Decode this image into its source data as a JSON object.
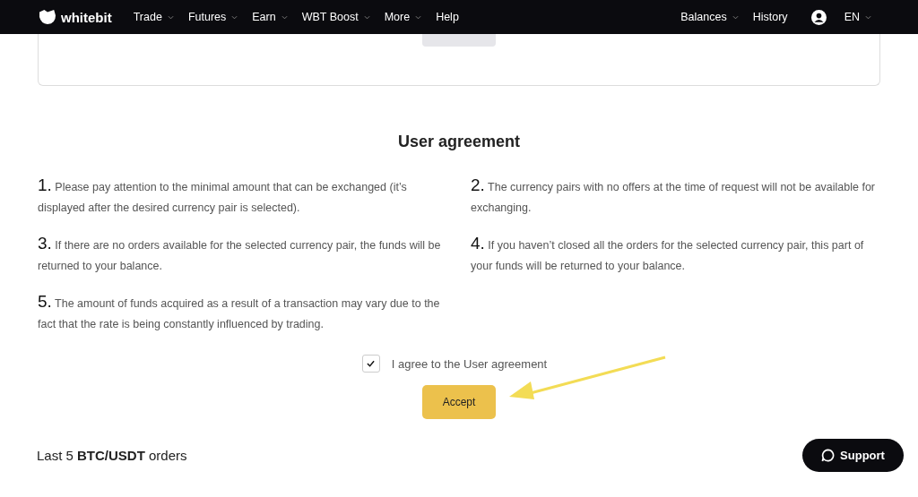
{
  "nav": {
    "logo": "whitebit",
    "menu": [
      {
        "label": "Trade",
        "dropdown": true
      },
      {
        "label": "Futures",
        "dropdown": true
      },
      {
        "label": "Earn",
        "dropdown": true
      },
      {
        "label": "WBT Boost",
        "dropdown": true
      },
      {
        "label": "More",
        "dropdown": true
      },
      {
        "label": "Help",
        "dropdown": false
      }
    ],
    "right": [
      {
        "label": "Balances",
        "dropdown": true
      },
      {
        "label": "History",
        "dropdown": false
      }
    ],
    "language": "EN"
  },
  "agreement": {
    "title": "User agreement",
    "items": [
      {
        "number": "1.",
        "text": "Please pay attention to the minimal amount that can be exchanged (it’s displayed after the desired currency pair is selected)."
      },
      {
        "number": "2.",
        "text": "The currency pairs with no offers at the time of request will not be available for exchanging."
      },
      {
        "number": "3.",
        "text": "If there are no orders available for the selected currency pair, the funds will be returned to your balance."
      },
      {
        "number": "4.",
        "text": "If you haven’t closed all the orders for the selected currency pair, this part of your funds will be returned to your balance."
      },
      {
        "number": "5.",
        "text": "The amount of funds acquired as a result of a transaction may vary due to the fact that the rate is being constantly influenced by trading."
      }
    ],
    "checkbox": {
      "label": "I agree to the User agreement",
      "checked": true
    },
    "button": "Accept"
  },
  "orders_heading": "Last 5 **BTC/USDT** orders",
  "support_button": "Support"
}
